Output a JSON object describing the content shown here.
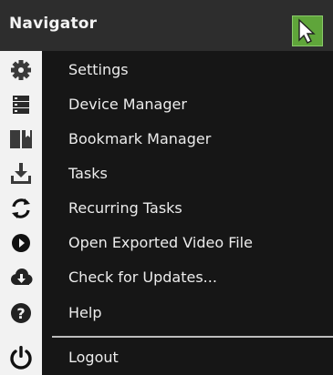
{
  "header": {
    "title": "Navigator"
  },
  "menu": {
    "items": [
      {
        "label": "Settings",
        "icon": "gear-icon"
      },
      {
        "label": "Device Manager",
        "icon": "server-icon"
      },
      {
        "label": "Bookmark Manager",
        "icon": "bookmark-book-icon"
      },
      {
        "label": "Tasks",
        "icon": "download-tray-icon"
      },
      {
        "label": "Recurring Tasks",
        "icon": "refresh-icon"
      },
      {
        "label": "Open Exported Video File",
        "icon": "play-circle-icon"
      },
      {
        "label": "Check for Updates...",
        "icon": "cloud-download-icon"
      },
      {
        "label": "Help",
        "icon": "help-circle-icon"
      },
      {
        "label": "Logout",
        "icon": "power-icon"
      }
    ]
  },
  "colors": {
    "menu_bg": "#161616",
    "title_bg": "#2d2d2d",
    "sidebar_bg": "#f2f2f2",
    "accent_green": "#5fa53a",
    "text": "#ececec"
  }
}
